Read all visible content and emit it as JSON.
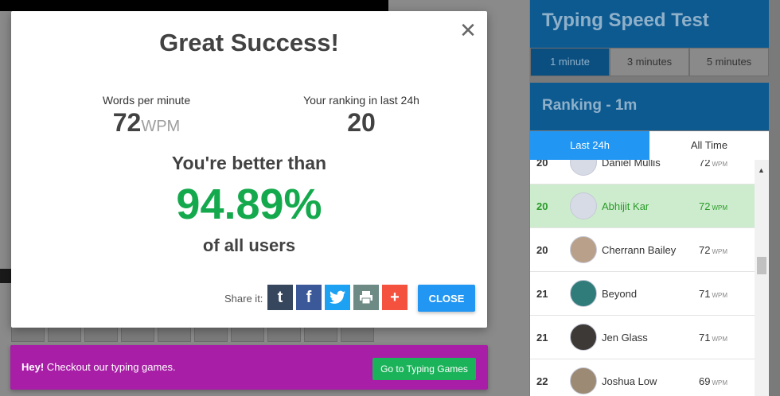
{
  "sidebar": {
    "test_title": "Typing Speed Test",
    "durations": [
      "1 minute",
      "3 minutes",
      "5 minutes"
    ],
    "active_duration": "1 minute",
    "ranking_title": "Ranking - 1m",
    "periods": [
      "Last 24h",
      "All Time"
    ],
    "active_period": "Last 24h",
    "rows": [
      {
        "rank": "20",
        "name": "Daniel Mullis",
        "wpm": "72",
        "unit": "WPM"
      },
      {
        "rank": "20",
        "name": "Abhijit Kar",
        "wpm": "72",
        "unit": "WPM",
        "highlight": true
      },
      {
        "rank": "20",
        "name": "Cherrann Bailey",
        "wpm": "72",
        "unit": "WPM"
      },
      {
        "rank": "21",
        "name": "Beyond",
        "wpm": "71",
        "unit": "WPM"
      },
      {
        "rank": "21",
        "name": "Jen Glass",
        "wpm": "71",
        "unit": "WPM"
      },
      {
        "rank": "22",
        "name": "Joshua Low",
        "wpm": "69",
        "unit": "WPM"
      }
    ]
  },
  "modal": {
    "title": "Great Success!",
    "wpm_label": "Words per minute",
    "wpm_value": "72",
    "wpm_unit": "WPM",
    "ranking_label": "Your ranking in last 24h",
    "ranking_value": "20",
    "better_than": "You're better than",
    "percent": "94.89%",
    "of_users": "of all users",
    "share_label": "Share it:",
    "close_label": "CLOSE",
    "share_buttons": [
      {
        "icon": "tumblr-icon",
        "glyph": "t",
        "color": "#36465d"
      },
      {
        "icon": "facebook-icon",
        "glyph": "f",
        "color": "#3b5998"
      },
      {
        "icon": "twitter-icon",
        "glyph": "🐦",
        "color": "#1da1f2"
      },
      {
        "icon": "print-icon",
        "glyph": "⎙",
        "color": "#6d8a84"
      },
      {
        "icon": "more-icon",
        "glyph": "+",
        "color": "#f4523f"
      }
    ]
  },
  "promo": {
    "bold": "Hey!",
    "text": " Checkout our typing games.",
    "button": "Go to Typing Games"
  }
}
